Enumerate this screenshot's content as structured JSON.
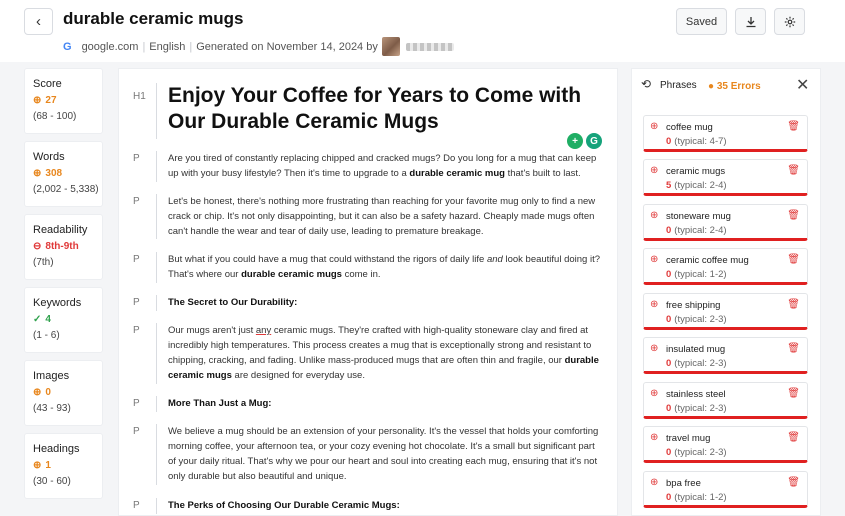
{
  "header": {
    "back_icon": "chevron-left-icon",
    "title": "durable ceramic mugs",
    "meta": {
      "source": "google.com",
      "language": "English",
      "generated": "Generated on November 14, 2024 by"
    },
    "saved_label": "Saved",
    "download_icon": "download-icon",
    "settings_icon": "gear-icon"
  },
  "stats": [
    {
      "label": "Score",
      "value": "27",
      "range": "(68 - 100)",
      "status": "below",
      "color": "#e8871e"
    },
    {
      "label": "Words",
      "value": "308",
      "range": "(2,002 - 5,338)",
      "status": "below",
      "color": "#e8871e"
    },
    {
      "label": "Readability",
      "value": "8th-9th",
      "range": "(7th)",
      "status": "above",
      "color": "#e03a3a"
    },
    {
      "label": "Keywords",
      "value": "4",
      "range": "(1 - 6)",
      "status": "ok",
      "color": "#2fa14c"
    },
    {
      "label": "Images",
      "value": "0",
      "range": "(43 - 93)",
      "status": "below",
      "color": "#e8871e"
    },
    {
      "label": "Headings",
      "value": "1",
      "range": "(30 - 60)",
      "status": "below",
      "color": "#e8871e"
    }
  ],
  "content": {
    "h1": {
      "tag": "H1",
      "text": "Enjoy Your Coffee for Years to Come with Our Durable Ceramic Mugs"
    },
    "p1": {
      "tag": "P",
      "before": "Are you tired of constantly replacing chipped and cracked mugs? Do you long for a mug that can keep up with your busy lifestyle? Then it's time to upgrade to a ",
      "bold": "durable ceramic mug",
      "after": " that's built to last."
    },
    "p2": {
      "tag": "P",
      "text": "Let's be honest, there's nothing more frustrating than reaching for your favorite mug only to find a new crack or chip. It's not only disappointing, but it can also be a safety hazard. Cheaply made mugs often can't handle the wear and tear of daily use, leading to premature breakage."
    },
    "p3": {
      "tag": "P",
      "before": "But what if you could have a mug that could withstand the rigors of daily life ",
      "italic": "and",
      "middle": " look beautiful doing it? That's where our ",
      "bold": "durable ceramic mugs",
      "after": " come in."
    },
    "p4": {
      "tag": "P",
      "text": "The Secret to Our Durability:"
    },
    "p5": {
      "tag": "P",
      "before": "Our mugs aren't just ",
      "underlined": "any",
      "middle": " ceramic mugs. They're crafted with high-quality stoneware clay and fired at incredibly high temperatures. This process creates a mug that is exceptionally strong and resistant to chipping, cracking, and fading. Unlike mass-produced mugs that are often thin and fragile, our ",
      "bold": "durable ceramic mugs",
      "after": " are designed for everyday use."
    },
    "p6": {
      "tag": "P",
      "text": "More Than Just a Mug:"
    },
    "p7": {
      "tag": "P",
      "text": "We believe a mug should be an extension of your personality. It's the vessel that holds your comforting morning coffee, your afternoon tea, or your cozy evening hot chocolate. It's a small but significant part of your daily ritual. That's why we pour our heart and soul into creating each mug, ensuring that it's not only durable but also beautiful and unique."
    },
    "p8": {
      "tag": "P",
      "text": "The Perks of Choosing Our Durable Ceramic Mugs:"
    }
  },
  "phrases_panel": {
    "title": "Phrases",
    "errors": "35 Errors",
    "close_icon": "close-icon",
    "items": [
      {
        "name": "coffee mug",
        "count": "0",
        "typical": "(typical: 4-7)"
      },
      {
        "name": "ceramic mugs",
        "count": "5",
        "typical": "(typical: 2-4)"
      },
      {
        "name": "stoneware mug",
        "count": "0",
        "typical": "(typical: 2-4)"
      },
      {
        "name": "ceramic coffee mug",
        "count": "0",
        "typical": "(typical: 1-2)"
      },
      {
        "name": "free shipping",
        "count": "0",
        "typical": "(typical: 2-3)"
      },
      {
        "name": "insulated mug",
        "count": "0",
        "typical": "(typical: 2-3)"
      },
      {
        "name": "stainless steel",
        "count": "0",
        "typical": "(typical: 2-3)"
      },
      {
        "name": "travel mug",
        "count": "0",
        "typical": "(typical: 2-3)"
      },
      {
        "name": "bpa free",
        "count": "0",
        "typical": "(typical: 1-2)"
      }
    ]
  }
}
